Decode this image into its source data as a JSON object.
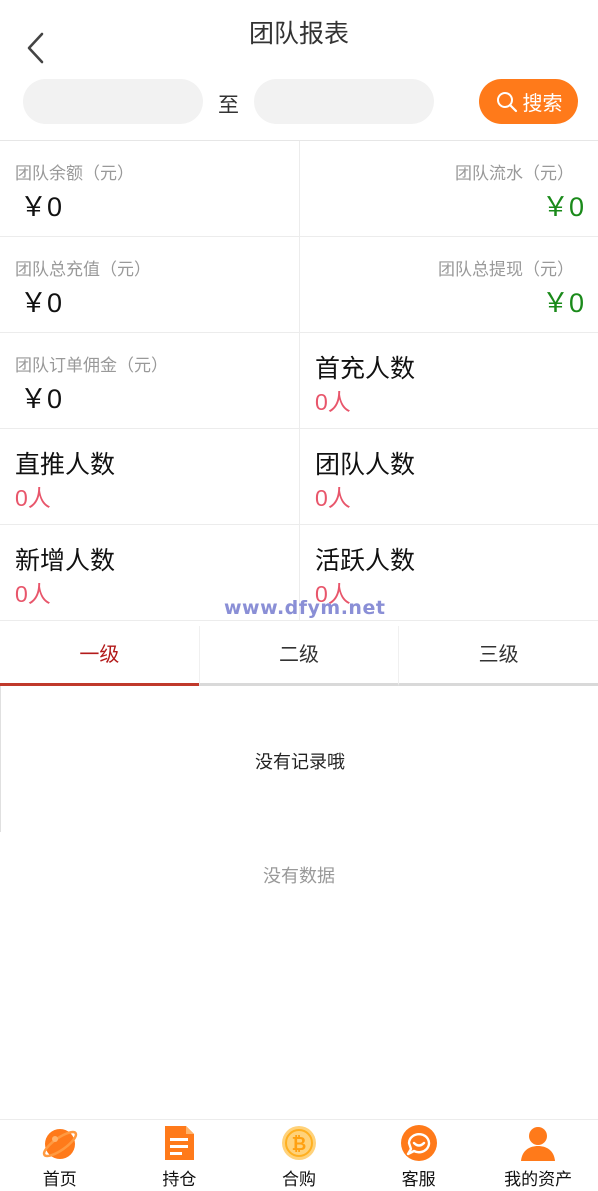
{
  "header": {
    "title": "团队报表"
  },
  "filter": {
    "separator": "至",
    "search_label": "搜索",
    "from_value": "",
    "to_value": ""
  },
  "stats": {
    "team_balance": {
      "label": "团队余额（元）",
      "value": "￥0"
    },
    "team_flow": {
      "label": "团队流水（元）",
      "value": "￥0"
    },
    "team_recharge": {
      "label": "团队总充值（元）",
      "value": "￥0"
    },
    "team_withdraw": {
      "label": "团队总提现（元）",
      "value": "￥0"
    },
    "team_commission": {
      "label": "团队订单佣金（元）",
      "value": "￥0"
    },
    "first_recharge": {
      "label": "首充人数",
      "value": "0人"
    },
    "direct_refs": {
      "label": "直推人数",
      "value": "0人"
    },
    "team_members": {
      "label": "团队人数",
      "value": "0人"
    },
    "new_members": {
      "label": "新增人数",
      "value": "0人"
    },
    "active_members": {
      "label": "活跃人数",
      "value": "0人"
    }
  },
  "watermark": "www.dfym.net",
  "tabs": [
    {
      "label": "一级",
      "active": true
    },
    {
      "label": "二级",
      "active": false
    },
    {
      "label": "三级",
      "active": false
    }
  ],
  "list": {
    "empty_message": "没有记录哦"
  },
  "no_data": "没有数据",
  "tabbar": [
    {
      "label": "首页",
      "icon": "home-planet-icon"
    },
    {
      "label": "持仓",
      "icon": "document-icon"
    },
    {
      "label": "合购",
      "icon": "bitcoin-icon"
    },
    {
      "label": "客服",
      "icon": "chat-icon"
    },
    {
      "label": "我的资产",
      "icon": "user-icon"
    }
  ],
  "colors": {
    "accent": "#ff7a1a",
    "positive": "#1a8a1a",
    "count": "#e8566b",
    "tab_active": "#b31b1b"
  }
}
